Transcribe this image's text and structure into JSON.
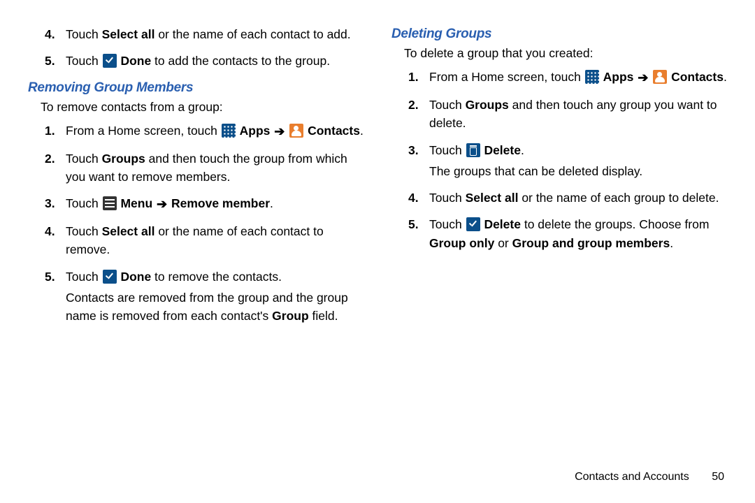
{
  "left": {
    "prev4": {
      "num": "4.",
      "t1": "Touch ",
      "b1": "Select all",
      "t2": " or the name of each contact to add."
    },
    "prev5": {
      "num": "5.",
      "t1": "Touch ",
      "b1": "Done",
      "t2": " to add the contacts to the group."
    },
    "heading": "Removing Group Members",
    "intro": "To remove contacts from a group:",
    "s1": {
      "num": "1.",
      "t1": "From a Home screen, touch ",
      "apps": "Apps",
      "contacts": "Contacts",
      "dot": "."
    },
    "s2": {
      "num": "2.",
      "t1": "Touch ",
      "b1": "Groups",
      "t2": " and then touch the group from which you want to remove members."
    },
    "s3": {
      "num": "3.",
      "t1": "Touch ",
      "b1": "Menu",
      "b2": "Remove member",
      "dot": "."
    },
    "s4": {
      "num": "4.",
      "t1": "Touch ",
      "b1": "Select all",
      "t2": " or the name of each contact to remove."
    },
    "s5": {
      "num": "5.",
      "t1": "Touch ",
      "b1": "Done",
      "t2": " to remove the contacts.",
      "after_a": "Contacts are removed from the group and the group name is removed from each contact's ",
      "after_b": "Group",
      "after_c": " field."
    }
  },
  "right": {
    "heading": "Deleting Groups",
    "intro": "To delete a group that you created:",
    "s1": {
      "num": "1.",
      "t1": "From a Home screen, touch ",
      "apps": "Apps",
      "contacts": "Contacts",
      "dot": "."
    },
    "s2": {
      "num": "2.",
      "t1": "Touch ",
      "b1": "Groups",
      "t2": " and then touch any group you want to delete."
    },
    "s3": {
      "num": "3.",
      "t1": "Touch ",
      "b1": "Delete",
      "dot": ".",
      "after": "The groups that can be deleted display."
    },
    "s4": {
      "num": "4.",
      "t1": "Touch ",
      "b1": "Select all",
      "t2": " or the name of each group to delete."
    },
    "s5": {
      "num": "5.",
      "t1": "Touch ",
      "b1": "Delete",
      "t2": " to delete the groups. Choose from ",
      "b2": "Group only",
      "t3": " or ",
      "b3": "Group and group members",
      "dot": "."
    }
  },
  "footer": {
    "section": "Contacts and Accounts",
    "page": "50"
  },
  "arrow": "➔"
}
